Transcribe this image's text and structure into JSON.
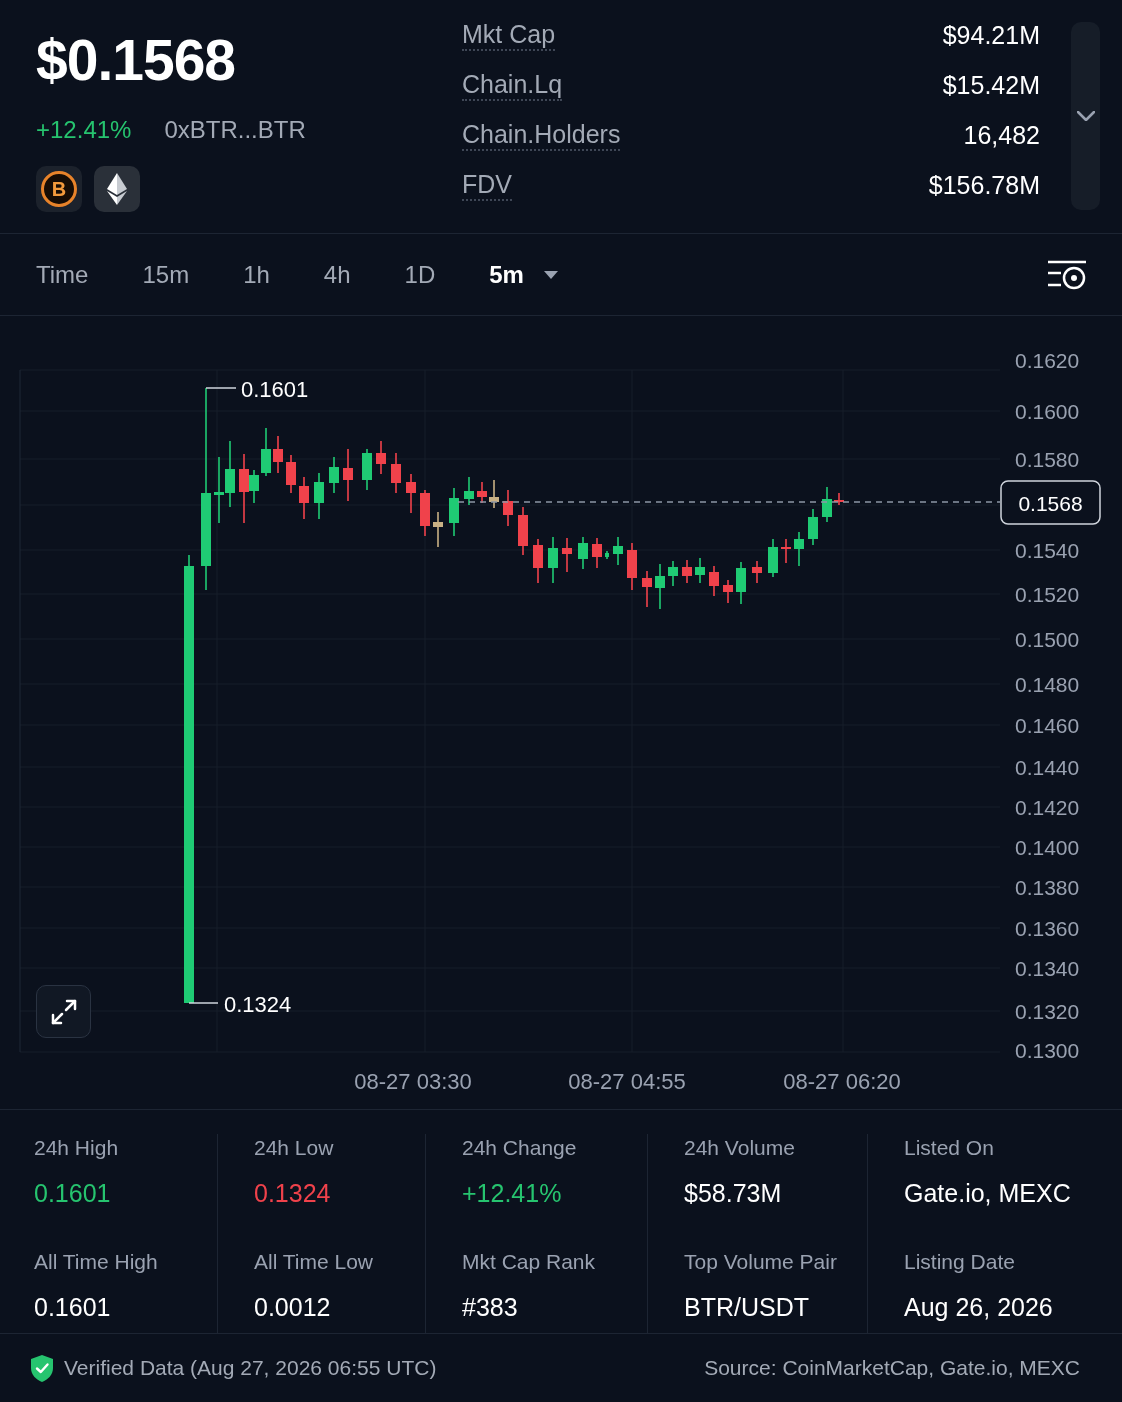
{
  "header": {
    "price": "$0.1568",
    "change": "+12.41%",
    "positive": true,
    "address": "0xBTR...BTR",
    "chains": [
      {
        "kind": "coin",
        "letter": "B"
      },
      {
        "kind": "diamond"
      }
    ]
  },
  "metrics": [
    {
      "label": "Mkt Cap",
      "value": "$94.21M"
    },
    {
      "label": "Chain.Lq",
      "value": "$15.42M"
    },
    {
      "label": "Chain.Holders",
      "value": "16,482"
    },
    {
      "label": "FDV",
      "value": "$156.78M"
    }
  ],
  "metrics_toggle": {
    "expanded": false
  },
  "timeframes": [
    {
      "label": "Time",
      "selected": false,
      "dropdown": false
    },
    {
      "label": "15m",
      "selected": false,
      "dropdown": false
    },
    {
      "label": "1h",
      "selected": false,
      "dropdown": false
    },
    {
      "label": "4h",
      "selected": false,
      "dropdown": false
    },
    {
      "label": "1D",
      "selected": false,
      "dropdown": false
    },
    {
      "label": "5m",
      "selected": true,
      "dropdown": true
    }
  ],
  "chart": {
    "y_labels": [
      "0.1620",
      "0.1600",
      "0.1580",
      "0.1540",
      "0.1520",
      "0.1500",
      "0.1480",
      "0.1460",
      "0.1440",
      "0.1420",
      "0.1400",
      "0.1380",
      "0.1360",
      "0.1340",
      "0.1320",
      "0.1300"
    ],
    "x_labels": [
      "08-27 03:30",
      "08-27 04:55",
      "08-27 06:20"
    ],
    "high_label": "0.1601",
    "low_label": "0.1324",
    "last_price": "0.1568"
  },
  "stats": [
    {
      "label": "24h High",
      "value": "0.1601",
      "color": "#26c46f"
    },
    {
      "label": "24h Low",
      "value": "0.1324",
      "color": "#f0424b"
    },
    {
      "label": "24h Change",
      "value": "+12.41%",
      "color": "#26c46f"
    },
    {
      "label": "24h Volume",
      "value": "$58.73M",
      "color": "#ffffff"
    },
    {
      "label": "Listed On",
      "value": "Gate.io, MEXC",
      "color": "#ffffff"
    },
    {
      "label": "All Time High",
      "value": "0.1601",
      "color": "#ffffff"
    },
    {
      "label": "All Time Low",
      "value": "0.0012",
      "color": "#ffffff"
    },
    {
      "label": "Mkt Cap Rank",
      "value": "#383",
      "color": "#ffffff"
    },
    {
      "label": "Top Volume Pair",
      "value": "BTR/USDT",
      "color": "#ffffff"
    },
    {
      "label": "Listing Date",
      "value": "Aug 26, 2026",
      "color": "#ffffff"
    }
  ],
  "footer": {
    "verified": "Verified Data (Aug 27, 2026 06:55 UTC)",
    "source": "Source: CoinMarketCap, Gate.io, MEXC"
  }
}
